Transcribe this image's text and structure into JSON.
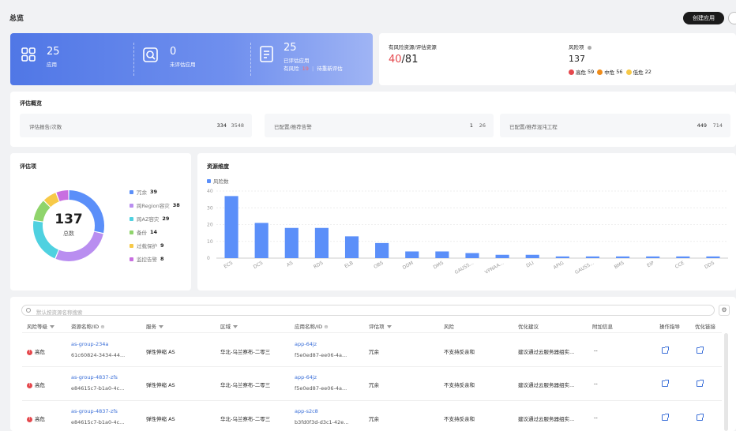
{
  "header": {
    "title": "总览",
    "create_button": "创建应用"
  },
  "stats": {
    "apps_num": "25",
    "apps_label": "应用",
    "unassessed_num": "0",
    "unassessed_label": "未评估应用",
    "assessed_num": "25",
    "assessed_label": "已评估应用",
    "risk_label": "有风险",
    "risk_count": "19",
    "pending_label": "待重新评估"
  },
  "risk_resources": {
    "label": "有风险资源/评估资源",
    "risk": "40",
    "total": "/81"
  },
  "risk_items": {
    "label": "风险项",
    "value": "137",
    "high_label": "高危",
    "high": "59",
    "mid_label": "中危",
    "mid": "56",
    "low_label": "低危",
    "low": "22"
  },
  "overview": {
    "title": "评估概览",
    "boxes": [
      {
        "label": "评估报告/次数",
        "a": "334",
        "b": "3548"
      },
      {
        "label": "已配置/推荐告警",
        "a": "1",
        "b": "26"
      },
      {
        "label": "已配置/推荐混沌工程",
        "a": "449",
        "b": "714"
      }
    ]
  },
  "donut": {
    "title": "评估项",
    "total": "137",
    "total_label": "总数",
    "items": [
      {
        "label": "冗余",
        "value": "39",
        "color": "#5b8ff9"
      },
      {
        "label": "跨Region容灾",
        "value": "38",
        "color": "#b98ef0"
      },
      {
        "label": "跨AZ容灾",
        "value": "29",
        "color": "#4fd1e0"
      },
      {
        "label": "备份",
        "value": "14",
        "color": "#8fd46b"
      },
      {
        "label": "过载保护",
        "value": "9",
        "color": "#f7c948"
      },
      {
        "label": "监控告警",
        "value": "8",
        "color": "#c86fe0"
      }
    ]
  },
  "chart_data": {
    "type": "bar",
    "title": "资源维度",
    "series": [
      {
        "name": "风险数",
        "values": [
          37,
          21,
          18,
          18,
          13,
          9,
          4,
          4,
          3,
          2,
          2,
          1,
          1,
          1,
          1,
          1,
          1
        ]
      }
    ],
    "categories": [
      "ECS",
      "DCS",
      "AS",
      "RDS",
      "ELB",
      "OBS",
      "DDM",
      "DMS",
      "GAUSS...",
      "VPNAA...",
      "DLI",
      "APIG",
      "GAUSS...",
      "BMS",
      "EIP",
      "CCE",
      "DDS"
    ],
    "ylim": [
      0,
      40
    ],
    "yticks": [
      "0",
      "10",
      "20",
      "30",
      "40"
    ],
    "color": "#5b8ff9",
    "grid": true,
    "legend": "top-left"
  },
  "table": {
    "search_placeholder": "默认按资源名称搜索",
    "headers": [
      "风险等级",
      "资源名称/ID",
      "服务",
      "区域",
      "应用名称/ID",
      "评估项",
      "风险",
      "优化建议",
      "附加信息",
      "操作指导",
      "优化链接"
    ],
    "rows": [
      {
        "level": "高危",
        "res_name": "as-group-234a",
        "res_id": "61c60824-3434-44...",
        "service": "弹性伸缩 AS",
        "region": "华北-乌兰察布-二零三",
        "app_name": "app-64jz",
        "app_id": "f5e0ed87-ee06-4a...",
        "item": "冗余",
        "risk": "不支持反亲和",
        "advice": "建议通过云服务器组实...",
        "extra": "--"
      },
      {
        "level": "高危",
        "res_name": "as-group-4837-zfs",
        "res_id": "e84615c7-b1a0-4c...",
        "service": "弹性伸缩 AS",
        "region": "华北-乌兰察布-二零三",
        "app_name": "app-64jz",
        "app_id": "f5e0ed87-ee06-4a...",
        "item": "冗余",
        "risk": "不支持反亲和",
        "advice": "建议通过云服务器组实...",
        "extra": "--"
      },
      {
        "level": "高危",
        "res_name": "as-group-4837-zfs",
        "res_id": "e84615c7-b1a0-4c...",
        "service": "弹性伸缩 AS",
        "region": "华北-乌兰察布-二零三",
        "app_name": "app-s2c8",
        "app_id": "b3fd0f3d-d3c1-42e...",
        "item": "冗余",
        "risk": "不支持反亲和",
        "advice": "建议通过云服务器组实...",
        "extra": "--"
      }
    ]
  }
}
